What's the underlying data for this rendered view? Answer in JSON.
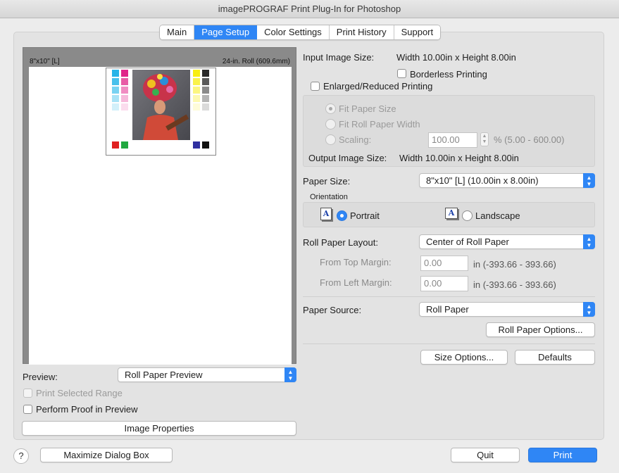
{
  "window": {
    "title": "imagePROGRAF Print Plug-In for Photoshop"
  },
  "tabs": [
    {
      "label": "Main"
    },
    {
      "label": "Page Setup"
    },
    {
      "label": "Color Settings"
    },
    {
      "label": "Print History"
    },
    {
      "label": "Support"
    }
  ],
  "active_tab": "Page Setup",
  "preview": {
    "paper_label": "8\"x10\" [L]",
    "roll_label": "24-in. Roll (609.6mm)",
    "preview_label": "Preview:",
    "preview_value": "Roll Paper Preview",
    "print_selected_range": "Print Selected Range",
    "perform_proof": "Perform Proof in Preview",
    "image_properties": "Image Properties"
  },
  "settings": {
    "input_size_label": "Input Image Size:",
    "input_size_value": "Width 10.00in x Height 8.00in",
    "borderless": "Borderless Printing",
    "enlarged": "Enlarged/Reduced Printing",
    "fit_paper": "Fit Paper Size",
    "fit_roll": "Fit Roll Paper Width",
    "scaling_label": "Scaling:",
    "scaling_value": "100.00",
    "scaling_range": "% (5.00 - 600.00)",
    "output_size_label": "Output Image Size:",
    "output_size_value": "Width 10.00in x Height 8.00in",
    "paper_size_label": "Paper Size:",
    "paper_size_value": "8\"x10\" [L] (10.00in x 8.00in)",
    "orientation_label": "Orientation",
    "portrait": "Portrait",
    "landscape": "Landscape",
    "orientation_icon_letter": "A",
    "roll_layout_label": "Roll Paper Layout:",
    "roll_layout_value": "Center of Roll Paper",
    "top_margin_label": "From Top Margin:",
    "top_margin_value": "0.00",
    "top_margin_range": "in (-393.66 - 393.66)",
    "left_margin_label": "From Left Margin:",
    "left_margin_value": "0.00",
    "left_margin_range": "in (-393.66 - 393.66)",
    "paper_source_label": "Paper Source:",
    "paper_source_value": "Roll Paper",
    "roll_options": "Roll Paper Options...",
    "size_options": "Size Options...",
    "defaults": "Defaults"
  },
  "footer": {
    "help": "?",
    "maximize": "Maximize Dialog Box",
    "quit": "Quit",
    "print": "Print"
  },
  "colors": {
    "accent": "#2f86f5"
  }
}
